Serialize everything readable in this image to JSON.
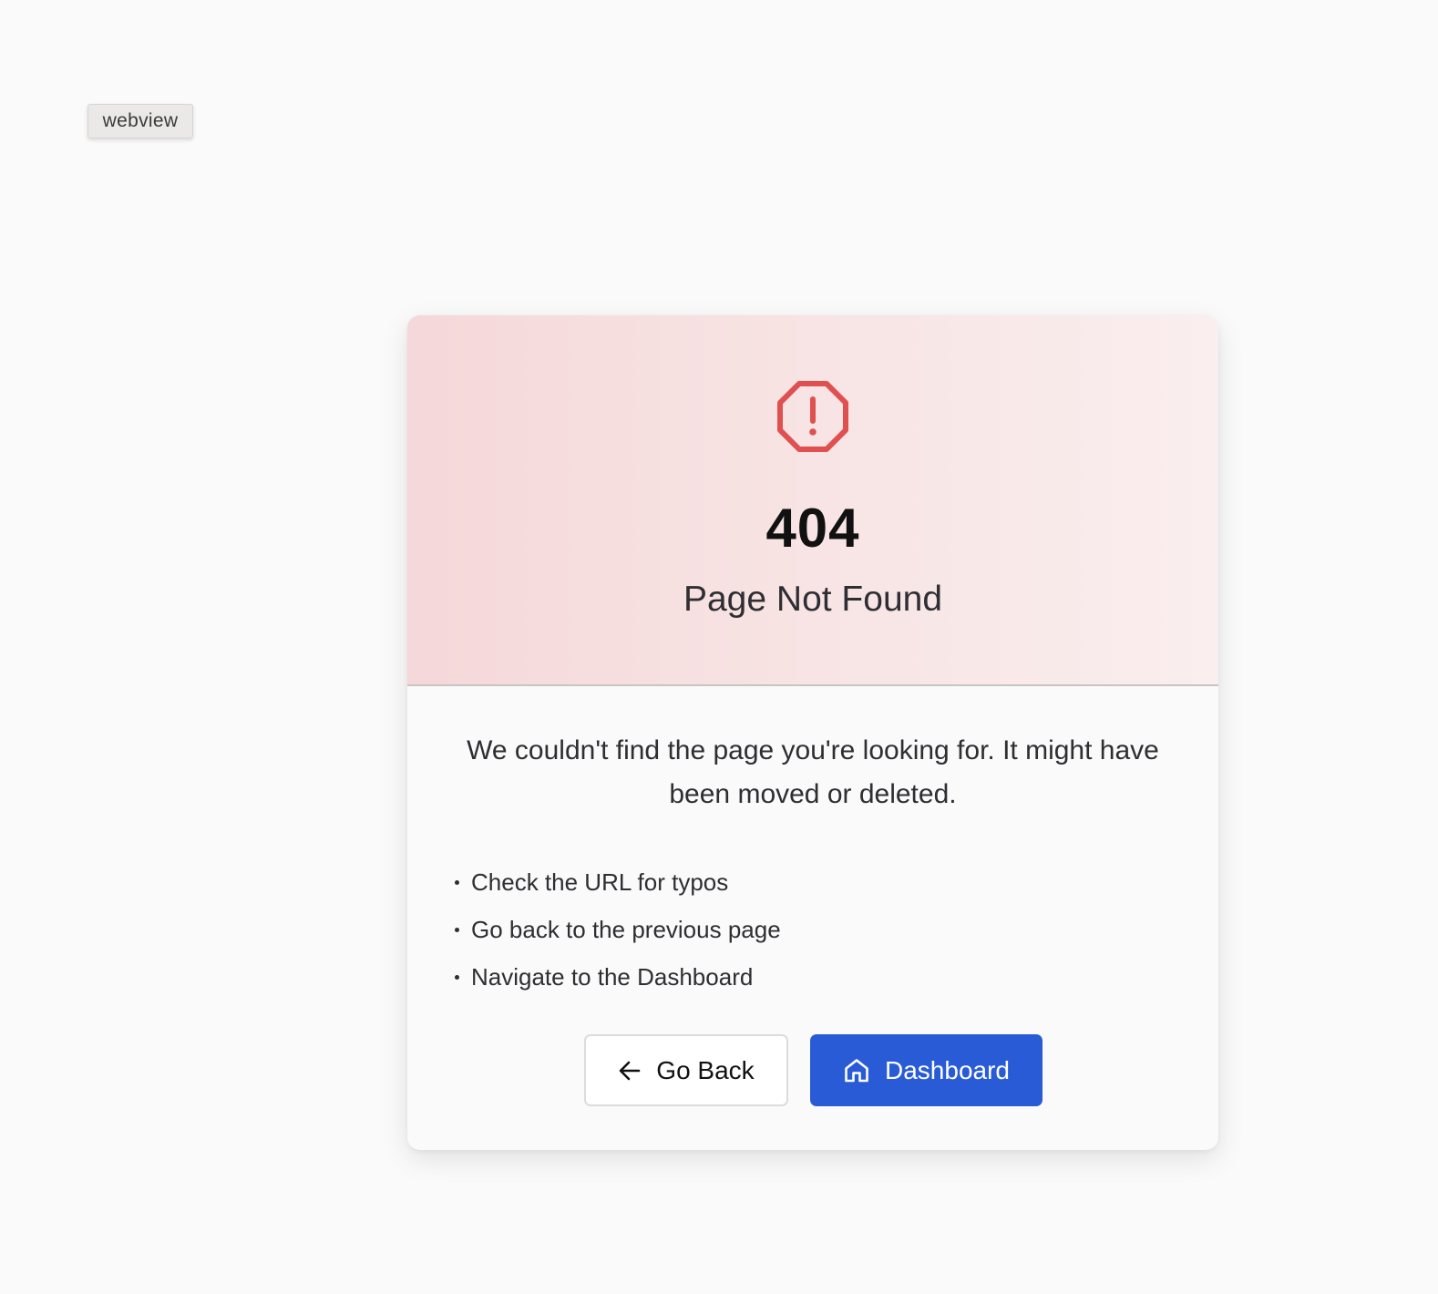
{
  "tag": {
    "label": "webview"
  },
  "header": {
    "icon": "alert-octagon-icon",
    "code": "404",
    "title": "Page Not Found"
  },
  "body": {
    "message": "We couldn't find the page you're looking for. It might have been moved or deleted.",
    "suggestions": [
      "Check the URL for typos",
      "Go back to the previous page",
      "Navigate to the Dashboard"
    ]
  },
  "actions": {
    "back": {
      "label": "Go Back",
      "icon": "arrow-left-icon"
    },
    "dashboard": {
      "label": "Dashboard",
      "icon": "home-icon"
    }
  },
  "colors": {
    "accent": "#2a5bd7",
    "danger": "#e05050",
    "header_bg": "#f6dcdd"
  }
}
